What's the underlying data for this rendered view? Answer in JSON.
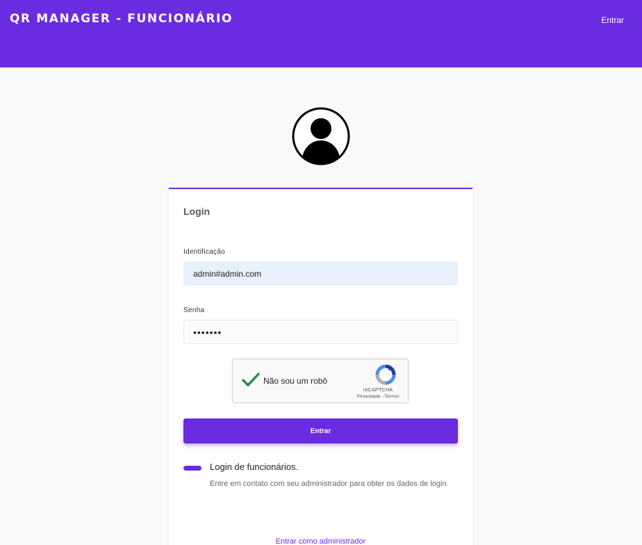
{
  "header": {
    "brand": "QR MANAGER - FUNCIONÁRIO",
    "login_link": "Entrar"
  },
  "icons": {
    "avatar": "user-avatar-icon",
    "check": "checkmark-icon",
    "recaptcha": "recaptcha-logo-icon"
  },
  "colors": {
    "primary": "#6a2ce0",
    "autofill": "#e8f0fe",
    "check_green": "#1e8e3e"
  },
  "login_card": {
    "title": "Login",
    "identification_label": "Identificação",
    "identification_value": "admin#admin.com",
    "password_label": "Senha",
    "password_value": "•••••••",
    "recaptcha": {
      "label": "Não sou um robô",
      "brand": "reCAPTCHA",
      "links": "Privacidade - Termos"
    },
    "submit_label": "Entrar",
    "info_title": "Login de funcionários.",
    "info_text": "Entre em contato com seu administrador para obter os dados de login.",
    "admin_link": "Entrar como administrador"
  }
}
